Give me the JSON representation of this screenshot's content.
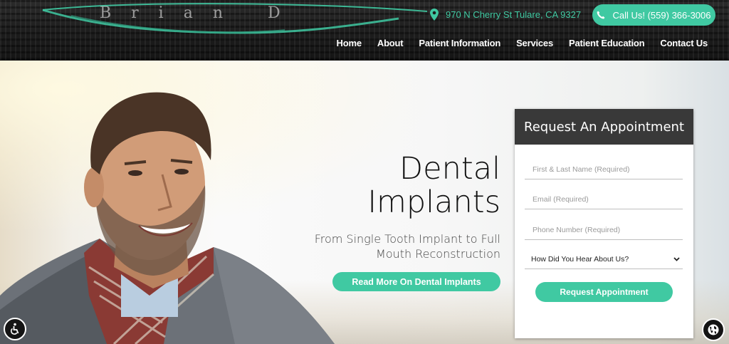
{
  "header": {
    "logo_text": "Brian D",
    "address": "970 N Cherry St Tulare, CA 9327",
    "call_label": "Call Us! (559) 366-3006",
    "nav": [
      "Home",
      "About",
      "Patient Information",
      "Services",
      "Patient Education",
      "Contact Us"
    ]
  },
  "hero": {
    "headline_line1": "Dental",
    "headline_line2": "Implants",
    "subtitle": "From Single Tooth Implant to Full Mouth Reconstruction",
    "cta_label": "Read More On Dental Implants"
  },
  "form": {
    "title": "Request An Appointment",
    "name_placeholder": "First & Last Name (Required)",
    "email_placeholder": "Email (Required)",
    "phone_placeholder": "Phone Number (Required)",
    "referral_select": "How Did You Hear About Us?",
    "submit_label": "Request Appointment"
  },
  "colors": {
    "accent": "#40c9a2",
    "form_header": "#393939",
    "header_bg": "#1d1d1d"
  },
  "icons": {
    "address": "map-pin-icon",
    "call": "phone-icon",
    "accessibility": "accessibility-icon",
    "language": "globe-icon",
    "select": "chevron-down-icon"
  }
}
